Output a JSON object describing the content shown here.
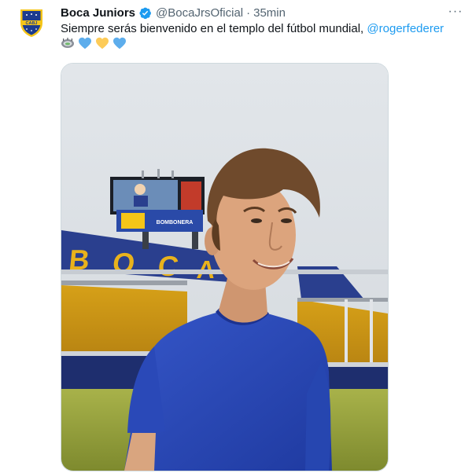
{
  "tweet": {
    "author_name": "Boca Juniors",
    "handle": "@BocaJrsOficial",
    "separator": "·",
    "time": "35min",
    "text": "Siempre serás bienvenido en el templo del fútbol mundial, ",
    "mention": "@rogerfederer",
    "more_label": "···"
  },
  "avatar": {
    "crest_text": "CABJ"
  },
  "stadium_sign": {
    "letters": [
      "B",
      "O",
      "C",
      "A"
    ],
    "board_text": "BOMBONERA"
  },
  "emojis": [
    "stadium-icon",
    "blue-heart-icon",
    "yellow-heart-icon",
    "blue-heart-icon"
  ],
  "colors": {
    "verified": "#1d9bf0",
    "mention": "#1d9bf0",
    "boca_blue": "#1b3b8f",
    "boca_yellow": "#f5c518",
    "shirt": "#2a49b8"
  }
}
